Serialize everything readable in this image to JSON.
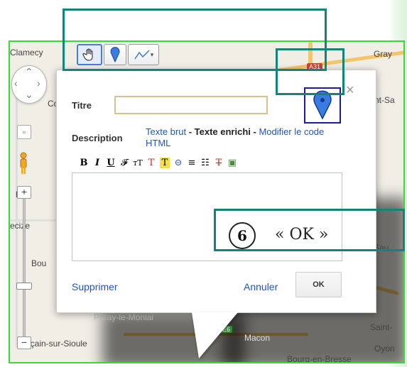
{
  "map": {
    "towns": [
      "Clamecy",
      "Gray",
      "Cor",
      "nt-Sa",
      "hine",
      "ecize",
      "Bou",
      "Paray-le-Monial",
      "Macon",
      "Saint-",
      "Oyon",
      "Sau",
      "urçain-sur-Sioule",
      "Bourg-en-Bresse"
    ],
    "road_badges": [
      "A31",
      "E6"
    ]
  },
  "toolbar": {
    "hand_tool": "hand-icon",
    "marker_tool": "map-pin-icon",
    "line_tool": "polyline-icon",
    "line_dropdown": "▾"
  },
  "infowindow": {
    "title_label": "Titre",
    "title_value": "",
    "description_label": "Description",
    "mode_plain": "Texte brut",
    "separator": " - ",
    "mode_rich": "Texte enrichi",
    "mode_html": "Modifier le code HTML",
    "rich_tools": [
      "B",
      "I",
      "U",
      "𝓕",
      "тT",
      "T",
      "T",
      "⊝",
      "≡",
      "☷",
      "T",
      "▣"
    ],
    "delete_label": "Supprimer",
    "cancel_label": "Annuler",
    "ok_label": "OK",
    "close_symbol": "×"
  },
  "annotation": {
    "step_number": "6",
    "step_text": "« OK »"
  },
  "colors": {
    "highlight": "#138479",
    "map_border": "#33dd33",
    "link": "#2255bb",
    "marker_box": "#1a1ab0"
  }
}
